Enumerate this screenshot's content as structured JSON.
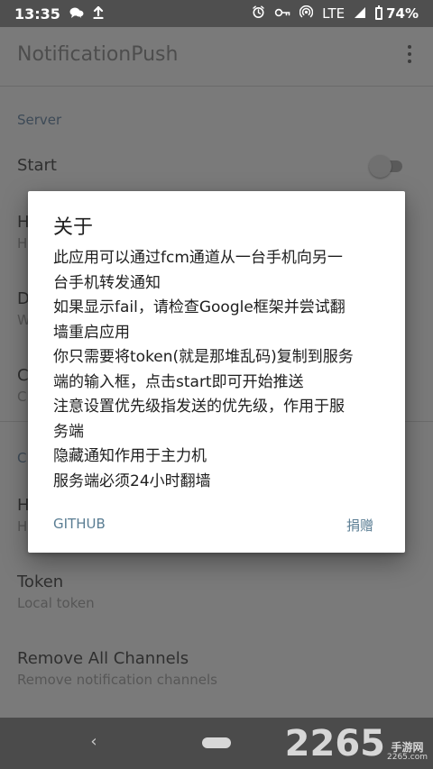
{
  "status_bar": {
    "time": "13:35",
    "left_icons": [
      "chat-icon",
      "upload-icon"
    ],
    "right_icons": [
      "alarm-icon",
      "vpn-key-icon",
      "hotspot-icon"
    ],
    "network_label": "LTE",
    "battery_percent": "74%",
    "battery_level": 0.74
  },
  "app_bar": {
    "title": "NotificationPush",
    "menu_icon": "more-vert-icon"
  },
  "settings": {
    "server_section_label": "Server",
    "start_label": "Start",
    "hidden_rows": [
      {
        "title": "H",
        "summary": "H"
      },
      {
        "title": "D",
        "summary": "W"
      },
      {
        "title": "C",
        "summary": "Cl"
      }
    ],
    "second_section_label": "Cl",
    "hidden_row_4": {
      "title": "H",
      "summary": "H"
    },
    "token_title": "Token",
    "token_summary": "Local token",
    "remove_channels_title": "Remove All Channels",
    "remove_channels_summary": "Remove notification channels",
    "start_enabled": false
  },
  "dialog": {
    "title": "关于",
    "lines": [
      "此应用可以通过fcm通道从一台手机向另一",
      "台手机转发通知",
      "如果显示fail，请检查Google框架并尝试翻",
      "墙重启应用",
      "你只需要将token(就是那堆乱码)复制到服务",
      "端的输入框，点击start即可开始推送",
      "注意设置优先级指发送的优先级，作用于服",
      "务端",
      "隐藏通知作用于主力机",
      "服务端必须24小时翻墙"
    ],
    "left_button": "GITHUB",
    "right_button": "捐赠"
  },
  "navigation": {
    "back_icon": "back-icon",
    "home_icon": "home-pill-icon"
  },
  "watermark": {
    "number": "2265",
    "top_text": "手游网",
    "bottom_text": "2265.com"
  },
  "theme": {
    "scrim": "#7a7a7a",
    "dialog_bg": "#ffffff",
    "accent": "#5a7d93",
    "statusbar_bg": "#4f4f4f",
    "navbar_bg": "#4b4b4b"
  }
}
